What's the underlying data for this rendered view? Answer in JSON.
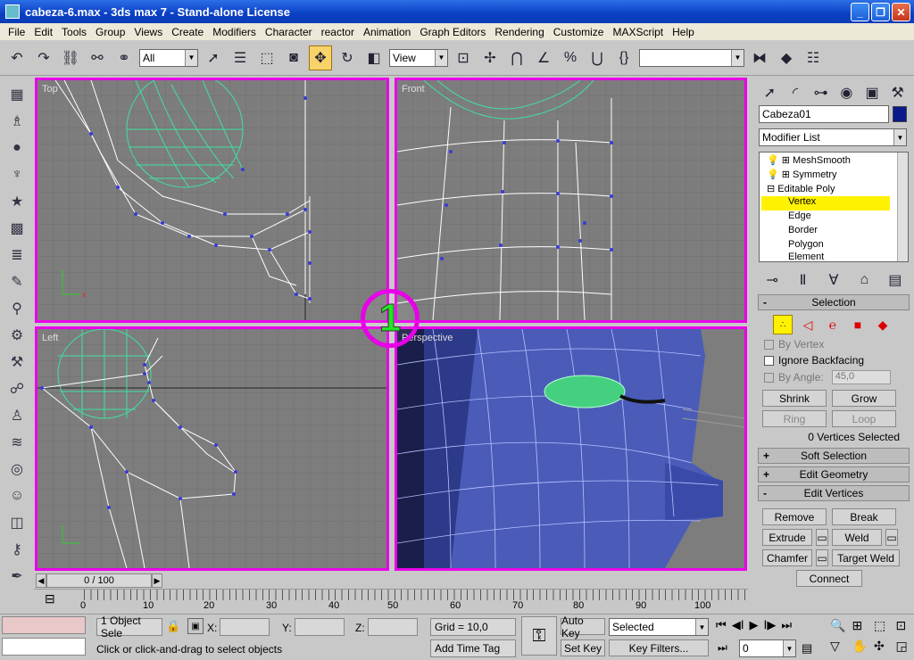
{
  "window": {
    "title": "cabeza-6.max - 3ds max 7 - Stand-alone License",
    "min": "_",
    "max": "❐",
    "close": "✕"
  },
  "menu": [
    "File",
    "Edit",
    "Tools",
    "Group",
    "Views",
    "Create",
    "Modifiers",
    "Character",
    "reactor",
    "Animation",
    "Graph Editors",
    "Rendering",
    "Customize",
    "MAXScript",
    "Help"
  ],
  "toolbar": {
    "selection_filter": "All",
    "ref_coord": "View",
    "named_sel": ""
  },
  "viewports": {
    "top": "Top",
    "front": "Front",
    "left": "Left",
    "perspective": "Perspective",
    "badge": "1"
  },
  "command_panel": {
    "object_name": "Cabeza01",
    "modifier_list": "Modifier List",
    "stack": [
      "MeshSmooth",
      "Symmetry",
      "Editable Poly",
      "Vertex",
      "Edge",
      "Border",
      "Polygon",
      "Element"
    ],
    "selection": {
      "title": "Selection",
      "by_vertex": "By Vertex",
      "ignore_backfacing": "Ignore Backfacing",
      "by_angle": "By Angle:",
      "angle_value": "45,0",
      "shrink": "Shrink",
      "grow": "Grow",
      "ring": "Ring",
      "loop": "Loop",
      "status": "0 Vertices Selected"
    },
    "soft_selection": "Soft Selection",
    "edit_geometry": "Edit Geometry",
    "edit_vertices": "Edit Vertices",
    "remove": "Remove",
    "break": "Break",
    "extrude": "Extrude",
    "weld": "Weld",
    "chamfer": "Chamfer",
    "target_weld": "Target Weld",
    "connect": "Connect"
  },
  "timeline": {
    "slider": "0 / 100",
    "ticks": [
      "0",
      "10",
      "20",
      "30",
      "40",
      "50",
      "60",
      "70",
      "80",
      "90",
      "100"
    ]
  },
  "status": {
    "selected": "1 Object Sele",
    "x_label": "X:",
    "y_label": "Y:",
    "z_label": "Z:",
    "grid": "Grid = 10,0",
    "auto_key": "Auto Key",
    "set_key": "Set Key",
    "key_mode": "Selected",
    "key_filters": "Key Filters...",
    "prompt": "Click or click-and-drag to select objects",
    "add_time_tag": "Add Time Tag",
    "frame": "0"
  }
}
